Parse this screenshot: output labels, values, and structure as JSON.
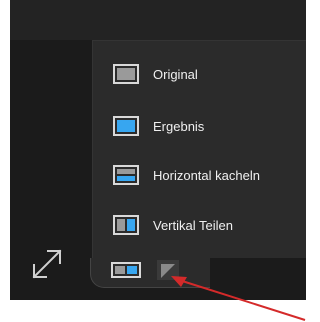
{
  "menu": {
    "items": [
      {
        "label": "Original",
        "icon": "layout-original-icon"
      },
      {
        "label": "Ergebnis",
        "icon": "layout-result-icon"
      },
      {
        "label": "Horizontal kacheln",
        "icon": "layout-horizontal-tile-icon"
      },
      {
        "label": "Vertikal Teilen",
        "icon": "layout-vertical-split-icon"
      }
    ]
  },
  "toolbar": {
    "expand_icon": "expand-icon",
    "view_mode_button_icon": "split-view-icon",
    "dropdown_icon": "triangle-icon"
  },
  "annotation": {
    "arrow_color": "#d42a2a"
  },
  "colors": {
    "accent": "#37a6f0",
    "panel": "#2b2b2b",
    "background": "#1b1b1b"
  }
}
